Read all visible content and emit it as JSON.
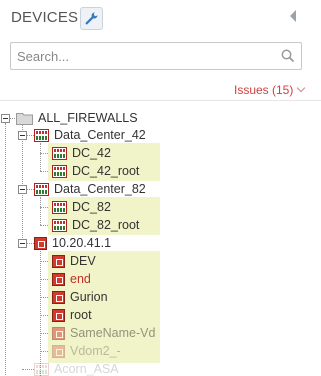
{
  "header": {
    "title": "DEVICES",
    "wrench_icon": "wrench-icon",
    "collapse_icon": "chevron-left-icon"
  },
  "search": {
    "placeholder": "Search...",
    "icon": "search-icon"
  },
  "issues": {
    "label": "Issues (15)"
  },
  "tree": {
    "root": "ALL_FIREWALLS",
    "groups": [
      {
        "name": "Data_Center_42",
        "children": [
          "DC_42",
          "DC_42_root"
        ]
      },
      {
        "name": "Data_Center_82",
        "children": [
          "DC_82",
          "DC_82_root"
        ]
      },
      {
        "name": "10.20.41.1",
        "children": [
          "DEV",
          "end",
          "Gurion",
          "root",
          "SameName-Vd",
          "Vdom2_-"
        ]
      }
    ],
    "partial_next": "Acorn_ASA"
  },
  "colors": {
    "issues": "#d04040",
    "leaf_highlight": "#f1f4c8",
    "vdom_red": "#d13a2f"
  }
}
